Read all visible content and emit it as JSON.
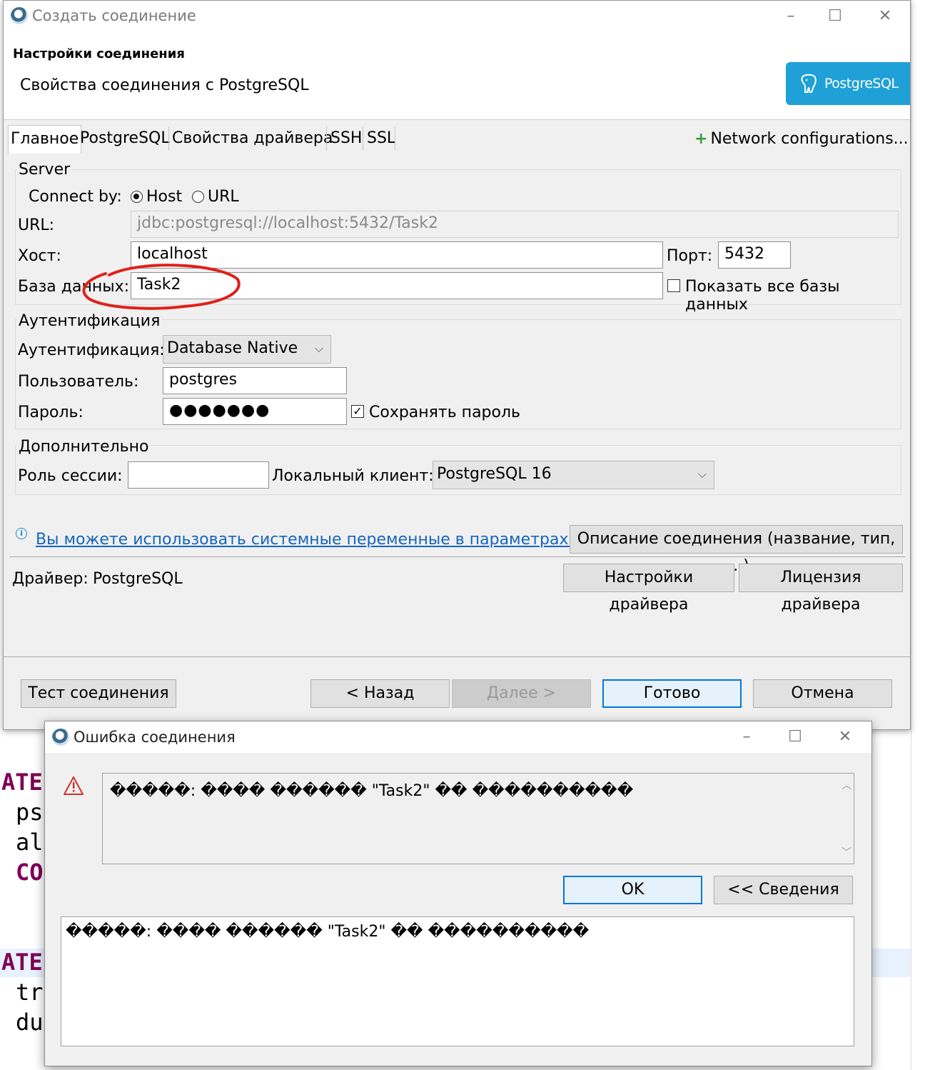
{
  "background": {
    "code_lines": [
      "ATE",
      "ps",
      "al",
      "CO",
      "ATE",
      "tr",
      "du"
    ]
  },
  "main_dialog": {
    "title": "Создать соединение",
    "header": {
      "title": "Настройки соединения",
      "subtitle": "Свойства соединения с PostgreSQL",
      "logo_text": "PostgreSQL"
    },
    "tabs": [
      "Главное",
      "PostgreSQL",
      "Свойства драйвера",
      "SSH",
      "SSL"
    ],
    "network_config": "Network configurations...",
    "server": {
      "group_label": "Server",
      "connect_by_label": "Connect by:",
      "option_host": "Host",
      "option_url": "URL",
      "url_label": "URL:",
      "url_value": "jdbc:postgresql://localhost:5432/Task2",
      "host_label": "Хост:",
      "host_value": "localhost",
      "port_label": "Порт:",
      "port_value": "5432",
      "db_label": "База данных:",
      "db_value": "Task2",
      "show_all_db": "Показать все базы данных"
    },
    "auth": {
      "group_label": "Аутентификация",
      "auth_label": "Аутентификация:",
      "auth_value": "Database Native",
      "user_label": "Пользователь:",
      "user_value": "postgres",
      "password_label": "Пароль:",
      "password_value": "●●●●●●●",
      "save_password": "Сохранять пароль"
    },
    "extra": {
      "group_label": "Дополнительно",
      "role_label": "Роль сессии:",
      "role_value": "",
      "local_client_label": "Локальный клиент:",
      "local_client_value": "PostgreSQL 16"
    },
    "info_link": "Вы можете использовать системные переменные в параметрах.",
    "describe_button": "Описание соединения (название, тип, ... )",
    "driver_label": "Драйвер:",
    "driver_value": "PostgreSQL",
    "driver_settings_button": "Настройки драйвера",
    "driver_license_button": "Лицензия драйвера",
    "buttons": {
      "test": "Тест соединения ...",
      "back": "< Назад",
      "next": "Далее >",
      "finish": "Готово",
      "cancel": "Отмена"
    }
  },
  "error_dialog": {
    "title": "Ошибка соединения",
    "message": "�����: ���� ������ \"Task2\" �� ����������",
    "ok_button": "OK",
    "details_button": "<< Сведения",
    "details_text": "�����: ���� ������ \"Task2\" �� ����������"
  },
  "colors": {
    "accent": "#0078d7",
    "logo_bg": "#1fa0d6",
    "annotation": "#e0201a",
    "link": "#1565c0",
    "keyword": "#7f0055"
  }
}
